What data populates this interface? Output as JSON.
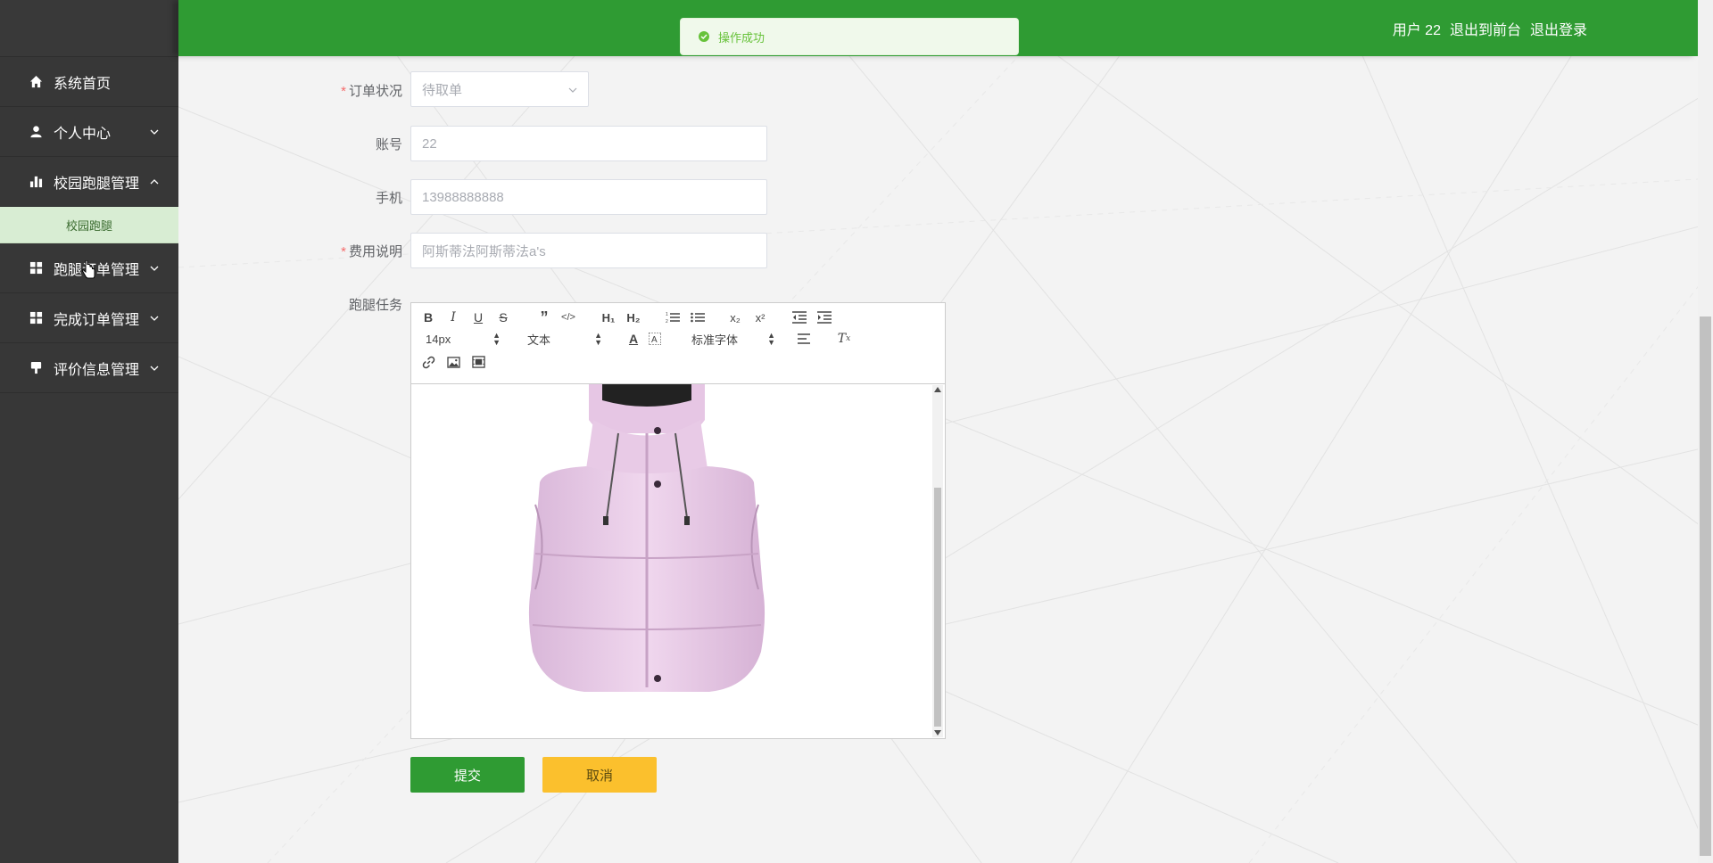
{
  "sidebar": {
    "items": [
      {
        "label": "系统首页",
        "icon": "home-icon"
      },
      {
        "label": "个人中心",
        "icon": "user-icon",
        "chevron": "down"
      },
      {
        "label": "校园跑腿管理",
        "icon": "bar-chart-icon",
        "chevron": "up",
        "submenu": [
          "校园跑腿"
        ]
      },
      {
        "label": "跑腿订单管理",
        "icon": "grid-icon",
        "chevron": "down"
      },
      {
        "label": "完成订单管理",
        "icon": "grid-icon",
        "chevron": "down"
      },
      {
        "label": "评价信息管理",
        "icon": "display-icon",
        "chevron": "down"
      }
    ]
  },
  "header": {
    "user": "用户 22",
    "exit_front": "退出到前台",
    "logout": "退出登录",
    "color": "#2f9b33"
  },
  "toast": {
    "message": "操作成功"
  },
  "form": {
    "order_status": {
      "label": "订单状况",
      "value": "待取单",
      "required": true
    },
    "account": {
      "label": "账号",
      "value": "22"
    },
    "phone": {
      "label": "手机",
      "value": "13988888888"
    },
    "fee_note": {
      "label": "费用说明",
      "value": "阿斯蒂法阿斯蒂法a's",
      "required": true
    },
    "task": {
      "label": "跑腿任务"
    }
  },
  "editor": {
    "font_size": "14px",
    "text_type": "文本",
    "font_family": "标准字体",
    "image_description": "pink puffer vest"
  },
  "buttons": {
    "submit": "提交",
    "cancel": "取消"
  }
}
